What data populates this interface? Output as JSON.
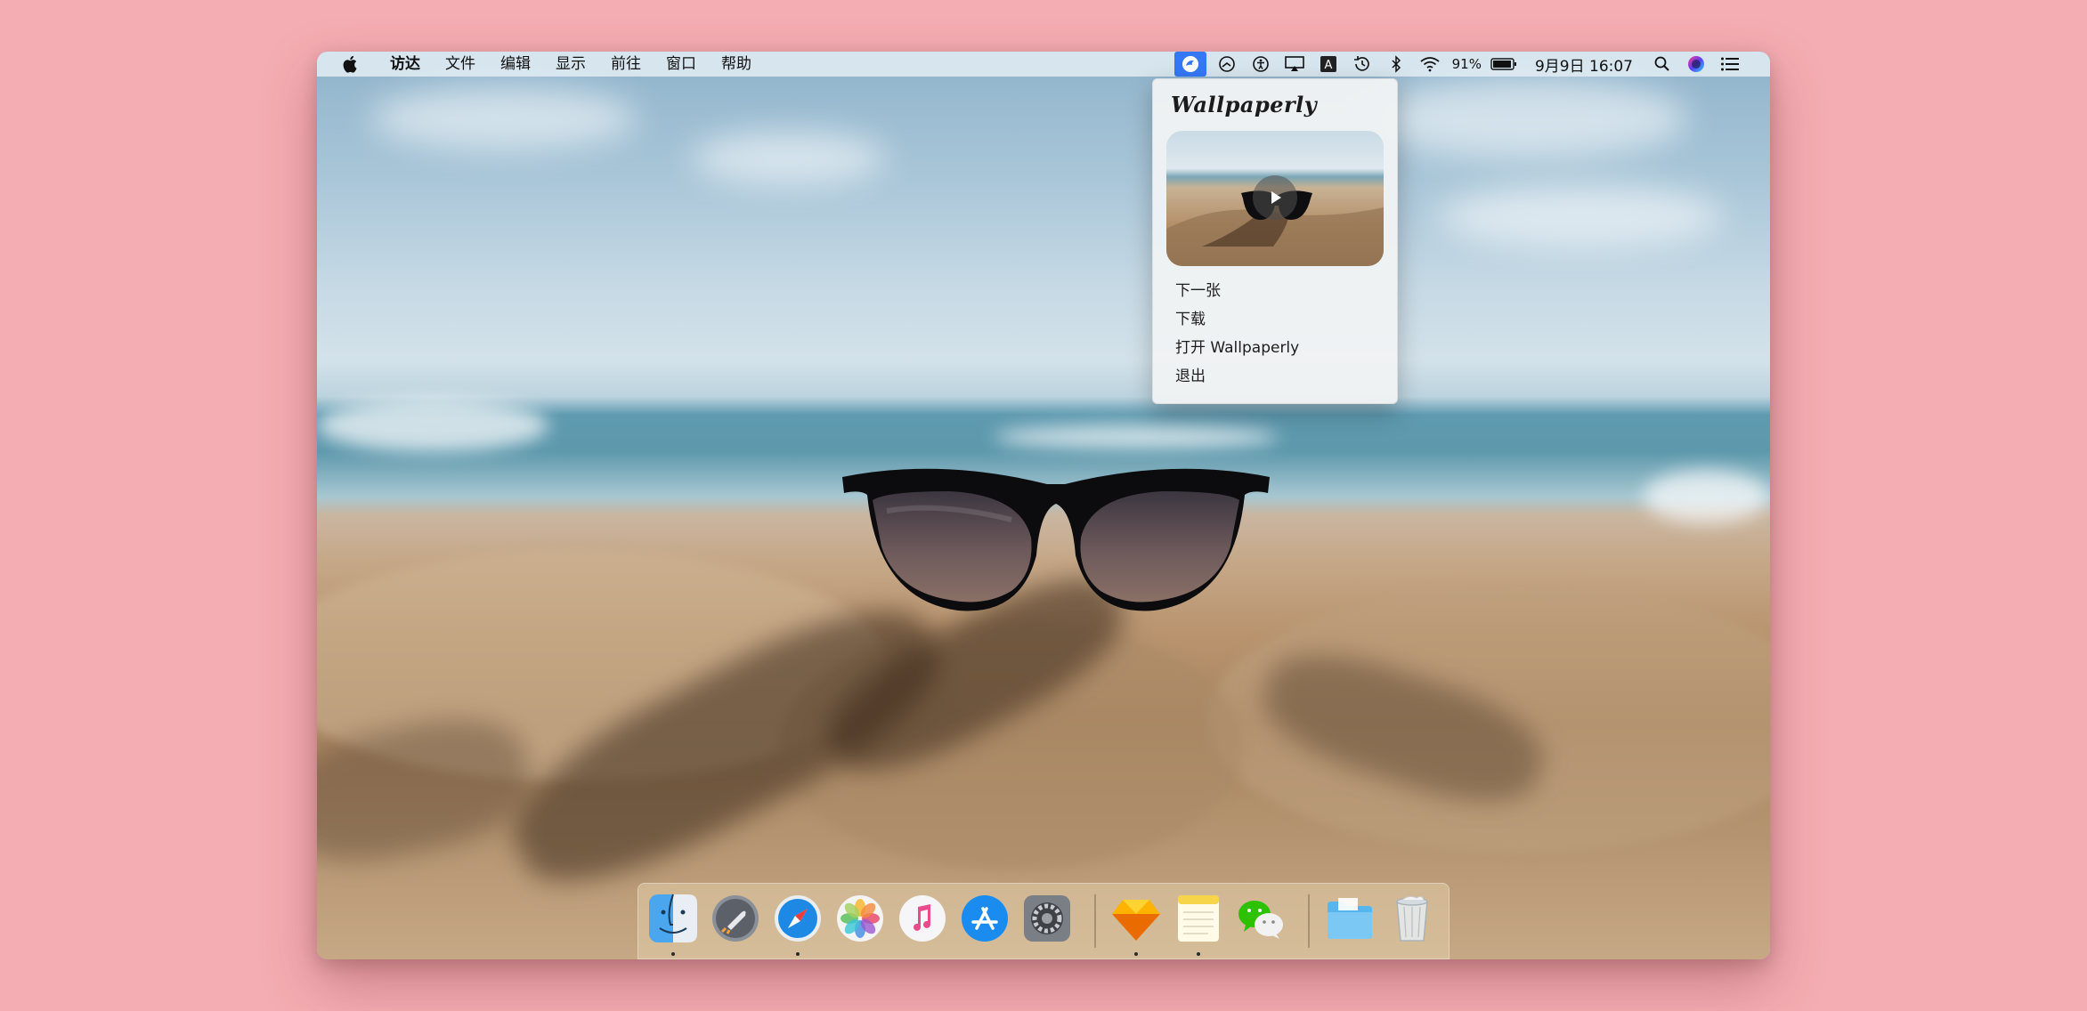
{
  "menubar": {
    "app_name": "访达",
    "items": [
      "文件",
      "编辑",
      "显示",
      "前往",
      "窗口",
      "帮助"
    ],
    "battery_percent": "91%",
    "clock": "9月9日 16:07"
  },
  "dropdown": {
    "title": "Wallpaperly",
    "items": [
      "下一张",
      "下载",
      "打开 Wallpaperly",
      "退出"
    ]
  },
  "dock": {
    "apps": [
      "finder-icon",
      "launchpad-icon",
      "safari-icon",
      "photos-icon",
      "music-icon",
      "app-store-icon",
      "system-preferences-icon",
      "sketch-icon",
      "notes-icon",
      "wechat-icon",
      "folder-icon",
      "trash-icon"
    ]
  },
  "colors": {
    "accent": "#3478f6",
    "background": "#f4adb2"
  }
}
